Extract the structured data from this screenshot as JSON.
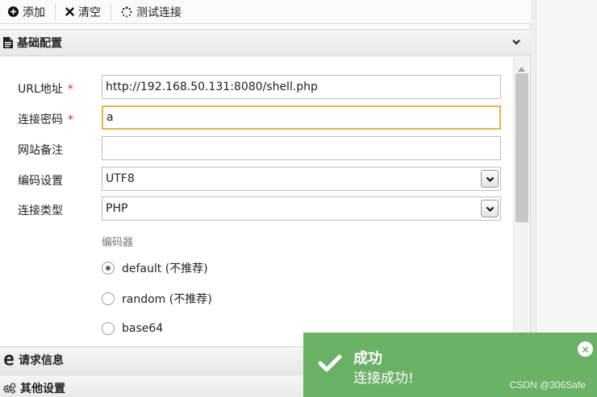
{
  "toolbar": {
    "add_label": "添加",
    "clear_label": "清空",
    "test_label": "测试连接"
  },
  "sections": {
    "basic": "基础配置",
    "request": "请求信息",
    "other": "其他设置"
  },
  "form": {
    "url_label": "URL地址",
    "url_value": "http://192.168.50.131:8080/shell.php",
    "password_label": "连接密码",
    "password_value": "a",
    "note_label": "网站备注",
    "note_value": "",
    "encoding_label": "编码设置",
    "encoding_value": "UTF8",
    "type_label": "连接类型",
    "type_value": "PHP",
    "required_mark": "*",
    "encoder_group_label": "编码器",
    "encoders": [
      {
        "label": "default (不推荐)",
        "selected": true
      },
      {
        "label": "random (不推荐)",
        "selected": false
      },
      {
        "label": "base64",
        "selected": false
      }
    ]
  },
  "toast": {
    "title": "成功",
    "message": "连接成功!",
    "close_symbol": "×"
  },
  "watermark": "CSDN @306Safe",
  "colors": {
    "toast_bg": "#62ac5c",
    "focus_border": "#e8b44c",
    "required": "#e02020"
  }
}
